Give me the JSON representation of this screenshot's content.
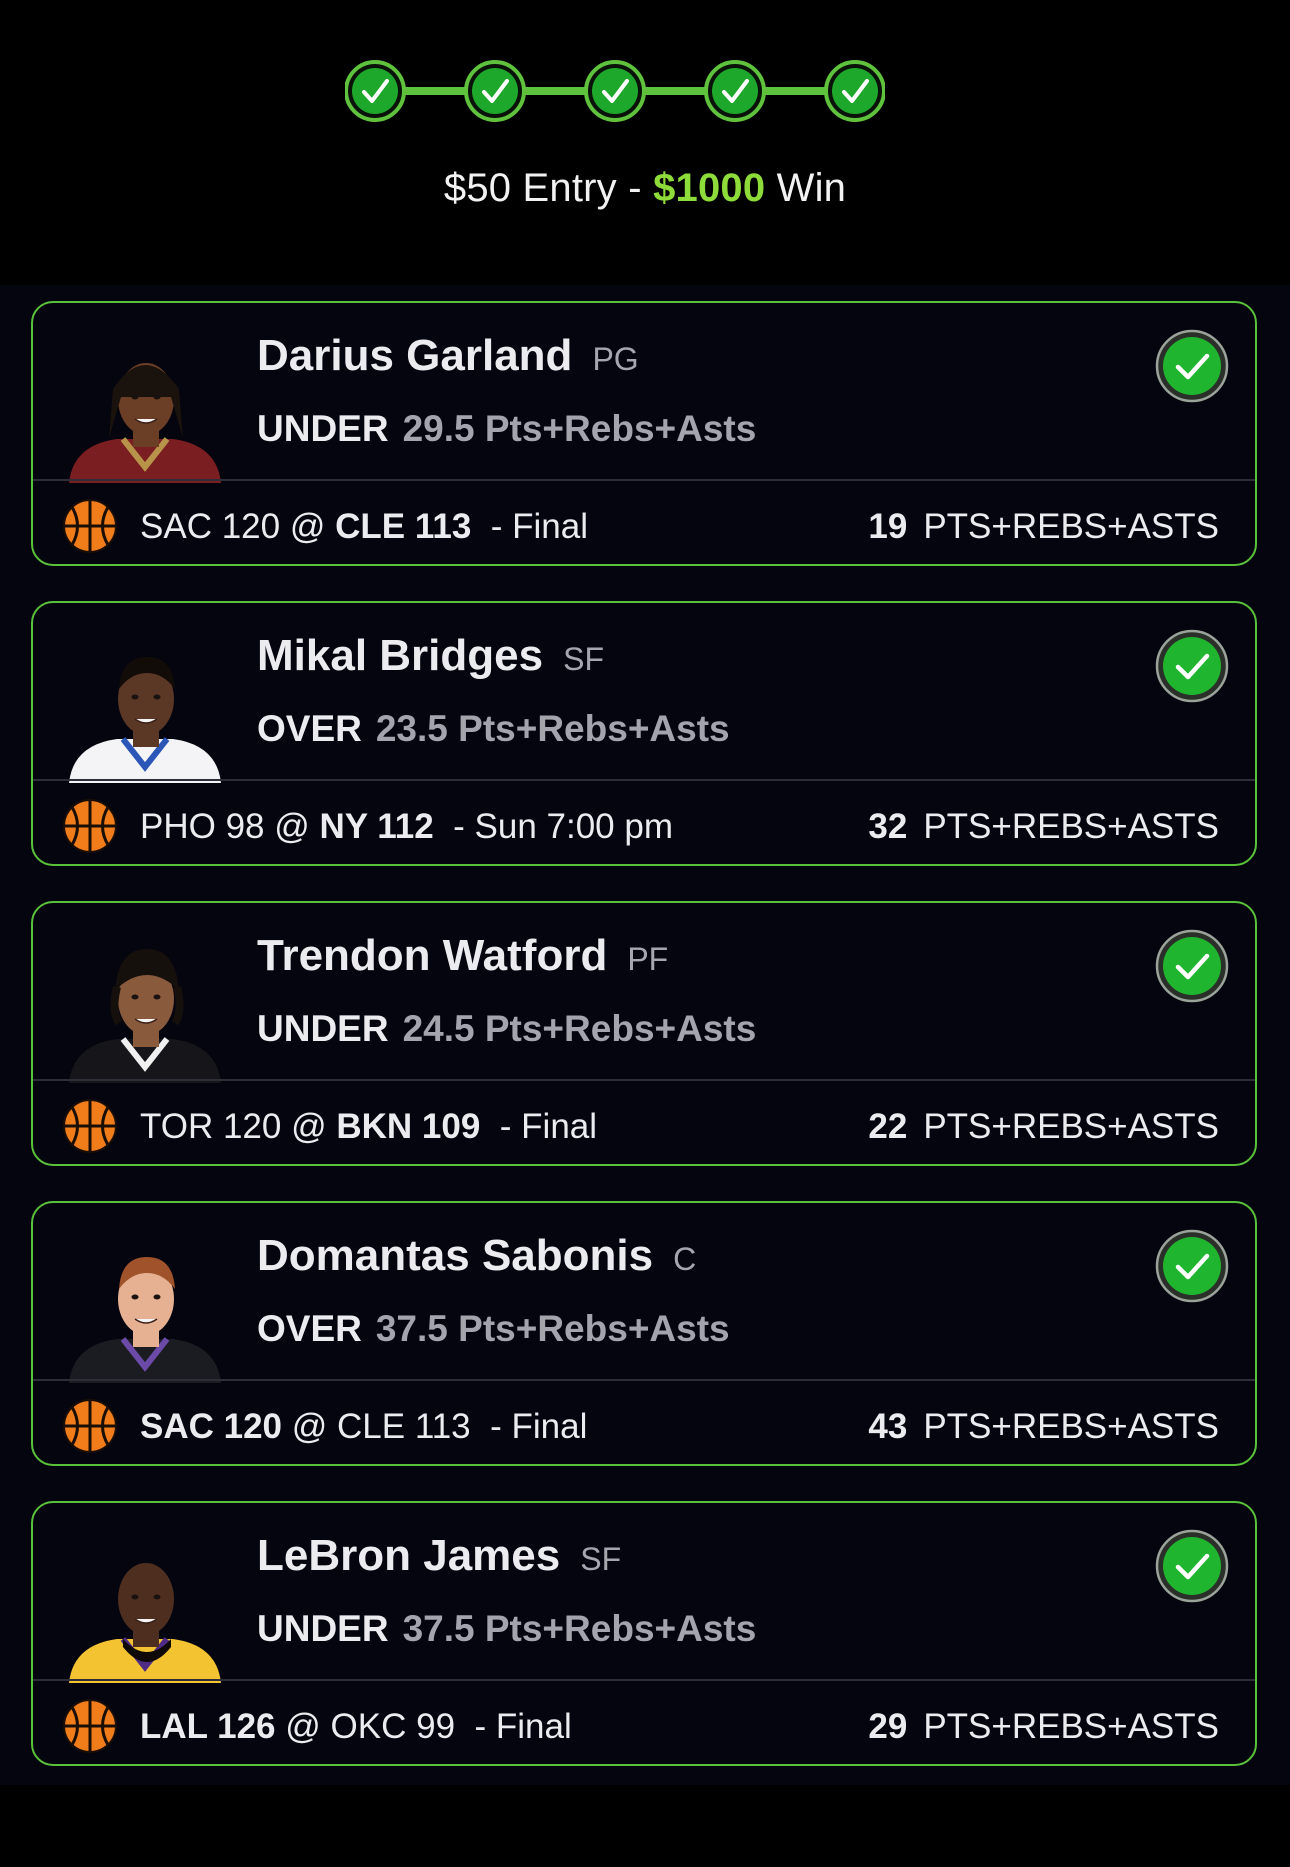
{
  "header": {
    "steps": [
      {
        "label": "leg-1",
        "status": "won"
      },
      {
        "label": "leg-2",
        "status": "won"
      },
      {
        "label": "leg-3",
        "status": "won"
      },
      {
        "label": "leg-4",
        "status": "won"
      },
      {
        "label": "leg-5",
        "status": "won"
      }
    ],
    "entry_text": "$50 Entry -",
    "win_amount": "$1000",
    "win_text": "Win"
  },
  "colors": {
    "accent_green": "#8ddc3a",
    "card_border": "#59c23a",
    "check_green": "#1fb52e",
    "ball_orange": "#f07d1a",
    "background": "#05050f"
  },
  "picks": [
    {
      "name": "Darius Garland",
      "position": "PG",
      "direction": "UNDER",
      "line": "29.5 Pts+Rebs+Asts",
      "game_pre": "SAC 120",
      "game_at": "@",
      "game_post": "CLE 113",
      "bold_team": "post",
      "game_status": "Final",
      "stat_value": "19",
      "stat_label": "PTS+REBS+ASTS",
      "avatar": {
        "skin": "#6b3e26",
        "hair": "#1a120d",
        "jersey": "#7b1e22",
        "trim": "#b8944a",
        "hair_style": "long"
      }
    },
    {
      "name": "Mikal Bridges",
      "position": "SF",
      "direction": "OVER",
      "line": "23.5 Pts+Rebs+Asts",
      "game_pre": "PHO 98",
      "game_at": "@",
      "game_post": "NY 112",
      "bold_team": "post",
      "game_status": "Sun 7:00 pm",
      "stat_value": "32",
      "stat_label": "PTS+REBS+ASTS",
      "avatar": {
        "skin": "#5b3725",
        "hair": "#120c09",
        "jersey": "#f4f4f6",
        "trim": "#2b56b8",
        "hair_style": "short"
      }
    },
    {
      "name": "Trendon Watford",
      "position": "PF",
      "direction": "UNDER",
      "line": "24.5 Pts+Rebs+Asts",
      "game_pre": "TOR 120",
      "game_at": "@",
      "game_post": "BKN 109",
      "bold_team": "post",
      "game_status": "Final",
      "stat_value": "22",
      "stat_label": "PTS+REBS+ASTS",
      "avatar": {
        "skin": "#8a5a3d",
        "hair": "#16100c",
        "jersey": "#15151a",
        "trim": "#f0f0f0",
        "hair_style": "curly"
      }
    },
    {
      "name": "Domantas Sabonis",
      "position": "C",
      "direction": "OVER",
      "line": "37.5 Pts+Rebs+Asts",
      "game_pre": "SAC 120",
      "game_at": "@",
      "game_post": "CLE 113",
      "bold_team": "pre",
      "game_status": "Final",
      "stat_value": "43",
      "stat_label": "PTS+REBS+ASTS",
      "avatar": {
        "skin": "#e6b192",
        "hair": "#a0532a",
        "jersey": "#1b1b22",
        "trim": "#6b4aa8",
        "hair_style": "short"
      }
    },
    {
      "name": "LeBron James",
      "position": "SF",
      "direction": "UNDER",
      "line": "37.5 Pts+Rebs+Asts",
      "game_pre": "LAL 126",
      "game_at": "@",
      "game_post": "OKC 99",
      "bold_team": "pre",
      "game_status": "Final",
      "stat_value": "29",
      "stat_label": "PTS+REBS+ASTS",
      "avatar": {
        "skin": "#4e2f1f",
        "hair": "#0f0a08",
        "jersey": "#f3c332",
        "trim": "#4f2b86",
        "hair_style": "bald"
      }
    }
  ]
}
